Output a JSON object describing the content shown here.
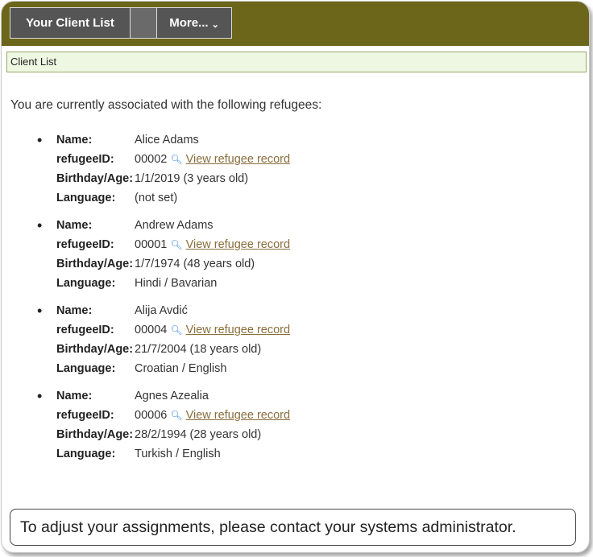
{
  "nav": {
    "tab_clients": "Your Client List",
    "tab_more": "More...",
    "more_chevron": "⌄"
  },
  "breadcrumb": "Client List",
  "intro": "You are currently associated with the following refugees:",
  "labels": {
    "name": "Name:",
    "id": "refugeeID:",
    "birthday": "Birthday/Age:",
    "language": "Language:"
  },
  "view_link": "View refugee record",
  "icons": {
    "bullet": "•",
    "view": "magnifier-icon"
  },
  "refugees": [
    {
      "name": "Alice Adams",
      "id": "00002",
      "birthday": "1/1/2019 (3 years old)",
      "language": "(not set)"
    },
    {
      "name": "Andrew Adams",
      "id": "00001",
      "birthday": "1/7/1974 (48 years old)",
      "language": "Hindi / Bavarian"
    },
    {
      "name": "Alija Avdić",
      "id": "00004",
      "birthday": "21/7/2004 (18 years old)",
      "language": "Croatian / English"
    },
    {
      "name": "Agnes Azealia",
      "id": "00006",
      "birthday": "28/2/1994 (28 years old)",
      "language": "Turkish / English"
    }
  ],
  "notice": "To adjust your assignments, please contact your systems administrator.",
  "colors": {
    "nav_bg": "#6b6619",
    "tab_bg": "#555555",
    "crumb_bg": "#eef7e2",
    "link": "#8a6d3b"
  }
}
